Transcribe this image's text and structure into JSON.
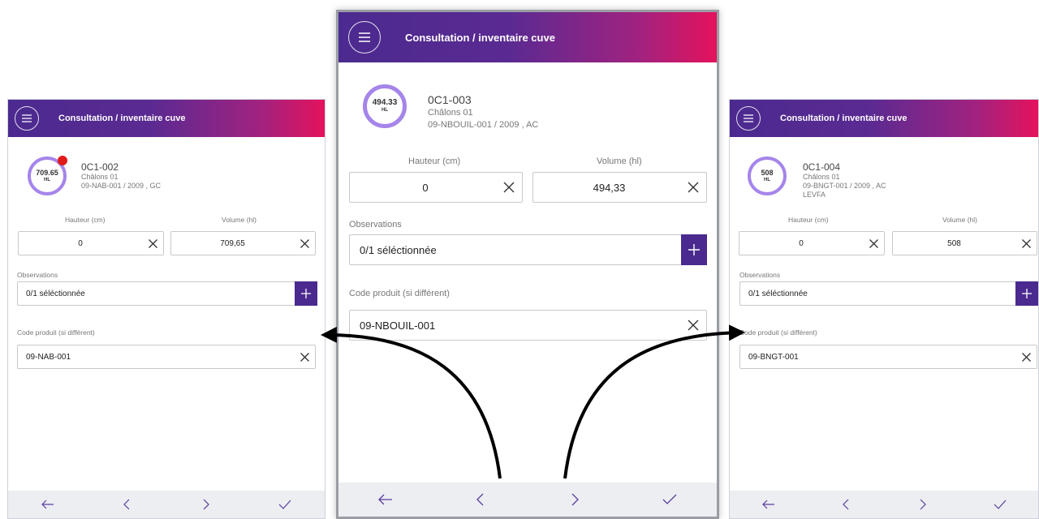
{
  "app": {
    "title": "Consultation / inventaire cuve"
  },
  "labels": {
    "height": "Hauteur (cm)",
    "volume": "Volume (hl)",
    "observations": "Observations",
    "product_code": "Code produit (si différent)"
  },
  "screens": {
    "left": {
      "tank_id": "0C1-002",
      "site": "Châlons 01",
      "batch": "09-NAB-001 / 2009 , GC",
      "ring_value": "709.65",
      "ring_unit": "HL",
      "height_value": "0",
      "volume_value": "709,65",
      "observations_value": "0/1 séléctionnée",
      "product_code_value": "09-NAB-001"
    },
    "center": {
      "tank_id": "0C1-003",
      "site": "Châlons 01",
      "batch": "09-NBOUIL-001 / 2009 , AC",
      "ring_value": "494.33",
      "ring_unit": "HL",
      "height_value": "0",
      "volume_value": "494,33",
      "observations_value": "0/1 séléctionnée",
      "product_code_value": "09-NBOUIL-001"
    },
    "right": {
      "tank_id": "0C1-004",
      "site": "Châlons 01",
      "batch": "09-BNGT-001 / 2009 , AC",
      "extra": "LEVFA",
      "ring_value": "508",
      "ring_unit": "HL",
      "height_value": "0",
      "volume_value": "508",
      "observations_value": "0/1 séléctionnée",
      "product_code_value": "09-BNGT-001"
    }
  },
  "icons": {
    "menu": "hamburger-icon",
    "clear": "close-icon",
    "add": "plus-icon",
    "back": "arrow-left-icon",
    "previous": "chevron-left-icon",
    "next": "chevron-right-icon",
    "validate": "check-icon"
  },
  "colors": {
    "header_start": "#4b2a8f",
    "header_end": "#e5125c",
    "accent": "#4a2a8e",
    "ring": "#a585ea",
    "alert": "#e11a1a",
    "footer_bg": "#eceef2"
  }
}
